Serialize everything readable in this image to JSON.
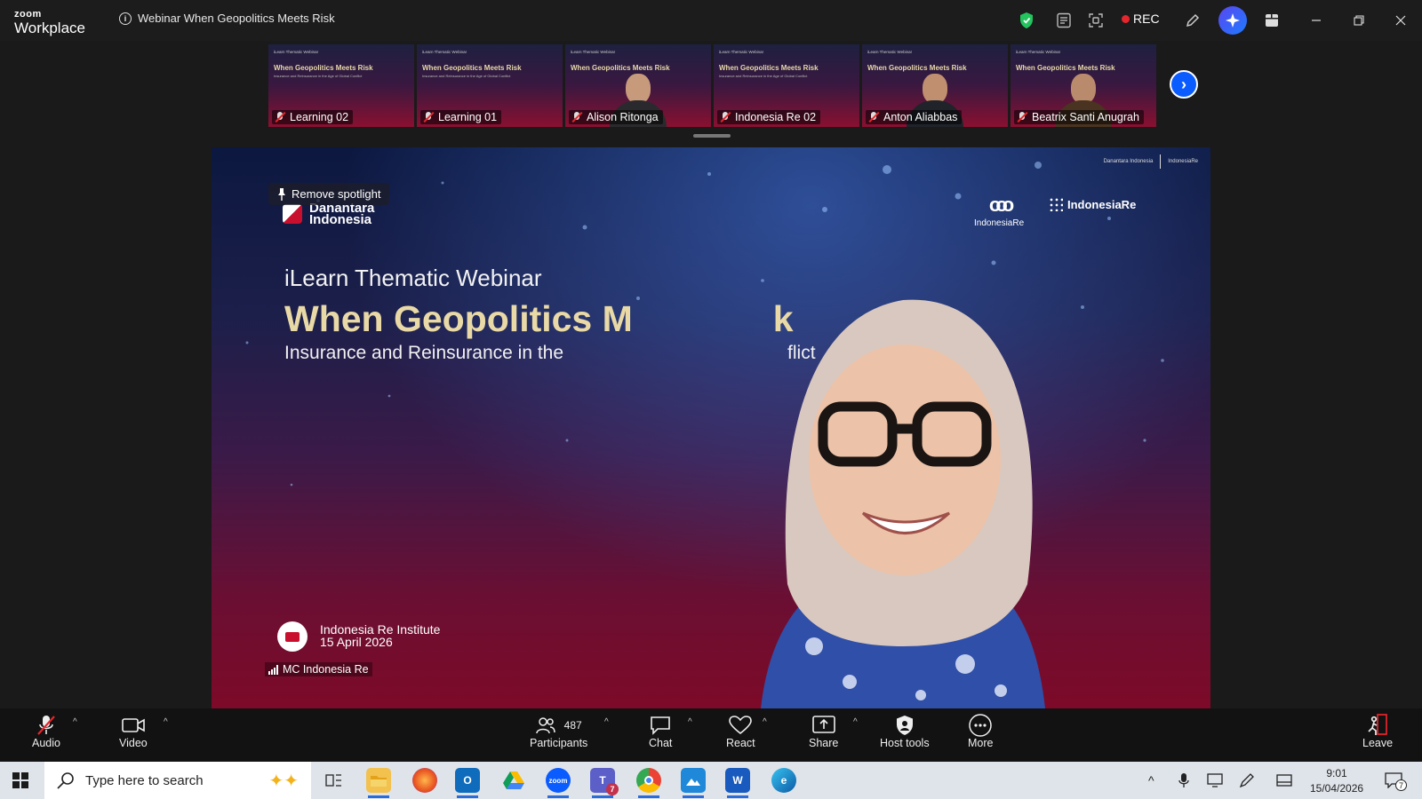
{
  "app": {
    "brand_small": "zoom",
    "brand_large": "Workplace"
  },
  "meeting": {
    "title": "Webinar When Geopolitics Meets Risk",
    "rec_label": "REC"
  },
  "thumbnails": [
    {
      "name": "Learning 02"
    },
    {
      "name": "Learning 01"
    },
    {
      "name": "Alison Ritonga"
    },
    {
      "name": "Indonesia Re 02"
    },
    {
      "name": "Anton Aliabbas"
    },
    {
      "name": "Beatrix Santi Anugrah"
    }
  ],
  "thumb_slide": {
    "kicker": "iLearn Thematic Webinar",
    "headline": "When Geopolitics Meets Risk",
    "sub": "Insurance and Reinsurance in the Age of Global Conflict"
  },
  "slide": {
    "spotlight_label": "Remove spotlight",
    "sponsor": "Danantara Indonesia",
    "sponsor_line1": "Danantara",
    "sponsor_line2": "Indonesia",
    "logo_ire": "IndonesiaRe",
    "logo_ire_institute": "IndonesiaRe",
    "kicker": "iLearn Thematic Webinar",
    "headline": "When Geopolitics M",
    "headline_tail": "k",
    "subtitle": "Insurance and Reinsurance in the",
    "subtitle_tail": "flict",
    "footer_org": "Indonesia Re Institute",
    "footer_date": "15 April 2026",
    "speaker_name": "MC Indonesia Re"
  },
  "controls": {
    "audio": "Audio",
    "video": "Video",
    "participants": "Participants",
    "participants_count": "487",
    "chat": "Chat",
    "react": "React",
    "share": "Share",
    "host_tools": "Host tools",
    "more": "More",
    "leave": "Leave"
  },
  "taskbar": {
    "search_placeholder": "Type here to search",
    "time": "9:01",
    "date": "15/04/2026",
    "teams_badge": "7",
    "notification_count": "7"
  },
  "colors": {
    "accent": "#0b5cff",
    "rec": "#e5262d",
    "headline": "#e9d9a6"
  }
}
